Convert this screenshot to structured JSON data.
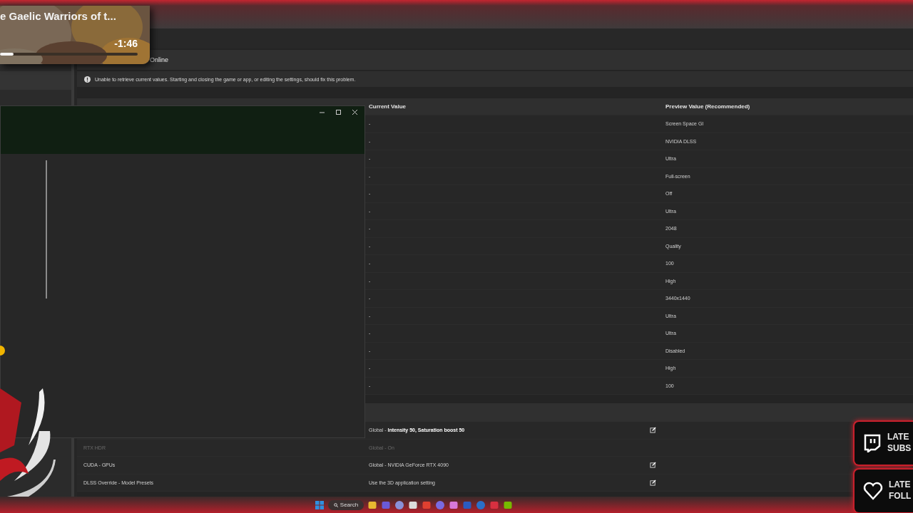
{
  "video_popup": {
    "title": "e Gaelic Warriors of t...",
    "remaining": "-1:46",
    "level": 0.1
  },
  "status": "Online",
  "notice": "Unable to retrieve current values. Starting and closing the game or app, or editing the settings, should fix this problem.",
  "game_settings": {
    "columns": [
      {
        "label": "Current Value"
      },
      {
        "label": "Preview Value (Recommended)"
      }
    ],
    "rows": [
      {
        "current": "-",
        "preview": "Screen Space GI"
      },
      {
        "current": "-",
        "preview": "NVIDIA DLSS"
      },
      {
        "current": "-",
        "preview": "Ultra"
      },
      {
        "current": "-",
        "preview": "Full-screen"
      },
      {
        "current": "-",
        "preview": "Off"
      },
      {
        "current": "-",
        "preview": "Ultra"
      },
      {
        "current": "-",
        "preview": "2048"
      },
      {
        "current": "-",
        "preview": "Quality"
      },
      {
        "current": "-",
        "preview": "100"
      },
      {
        "current": "-",
        "preview": "High"
      },
      {
        "current": "-",
        "preview": "3440x1440"
      },
      {
        "current": "-",
        "preview": "Ultra"
      },
      {
        "current": "-",
        "preview": "Ultra"
      },
      {
        "current": "-",
        "preview": "Disabled"
      },
      {
        "current": "-",
        "preview": "High"
      },
      {
        "current": "-",
        "preview": "100"
      }
    ]
  },
  "driver_settings": {
    "rows": [
      {
        "value": "Global - **Intensity 50, Saturation boost 50**",
        "disabled": false,
        "editable": true
      },
      {
        "name": "RTX HDR",
        "value": "Global - On",
        "disabled": true,
        "editable": false
      },
      {
        "name": "CUDA - GPUs",
        "value": "Global - NVIDIA GeForce RTX 4090",
        "disabled": false,
        "editable": true
      },
      {
        "name": "DLSS Override - Model Presets",
        "value": "Use the 3D application setting",
        "disabled": false,
        "editable": true
      }
    ]
  },
  "stream_alerts": [
    {
      "kind": "subscriber",
      "lines": [
        "LATE",
        "SUBS"
      ]
    },
    {
      "kind": "follower",
      "lines": [
        "LATE",
        "FOLL"
      ]
    }
  ],
  "taskbar": {
    "search": "Search"
  }
}
